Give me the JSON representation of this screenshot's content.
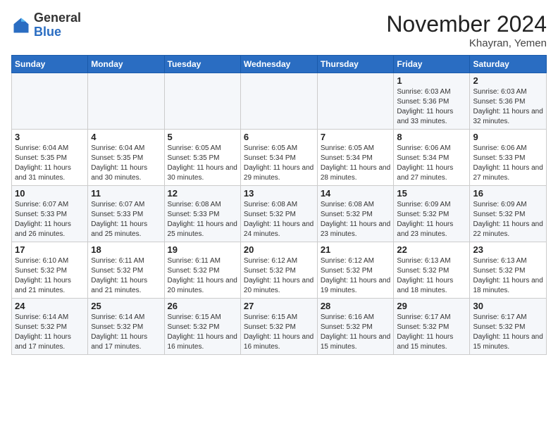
{
  "header": {
    "logo_general": "General",
    "logo_blue": "Blue",
    "month_year": "November 2024",
    "location": "Khayran, Yemen"
  },
  "weekdays": [
    "Sunday",
    "Monday",
    "Tuesday",
    "Wednesday",
    "Thursday",
    "Friday",
    "Saturday"
  ],
  "weeks": [
    [
      {
        "day": "",
        "info": ""
      },
      {
        "day": "",
        "info": ""
      },
      {
        "day": "",
        "info": ""
      },
      {
        "day": "",
        "info": ""
      },
      {
        "day": "",
        "info": ""
      },
      {
        "day": "1",
        "info": "Sunrise: 6:03 AM\nSunset: 5:36 PM\nDaylight: 11 hours and 33 minutes."
      },
      {
        "day": "2",
        "info": "Sunrise: 6:03 AM\nSunset: 5:36 PM\nDaylight: 11 hours and 32 minutes."
      }
    ],
    [
      {
        "day": "3",
        "info": "Sunrise: 6:04 AM\nSunset: 5:35 PM\nDaylight: 11 hours and 31 minutes."
      },
      {
        "day": "4",
        "info": "Sunrise: 6:04 AM\nSunset: 5:35 PM\nDaylight: 11 hours and 30 minutes."
      },
      {
        "day": "5",
        "info": "Sunrise: 6:05 AM\nSunset: 5:35 PM\nDaylight: 11 hours and 30 minutes."
      },
      {
        "day": "6",
        "info": "Sunrise: 6:05 AM\nSunset: 5:34 PM\nDaylight: 11 hours and 29 minutes."
      },
      {
        "day": "7",
        "info": "Sunrise: 6:05 AM\nSunset: 5:34 PM\nDaylight: 11 hours and 28 minutes."
      },
      {
        "day": "8",
        "info": "Sunrise: 6:06 AM\nSunset: 5:34 PM\nDaylight: 11 hours and 27 minutes."
      },
      {
        "day": "9",
        "info": "Sunrise: 6:06 AM\nSunset: 5:33 PM\nDaylight: 11 hours and 27 minutes."
      }
    ],
    [
      {
        "day": "10",
        "info": "Sunrise: 6:07 AM\nSunset: 5:33 PM\nDaylight: 11 hours and 26 minutes."
      },
      {
        "day": "11",
        "info": "Sunrise: 6:07 AM\nSunset: 5:33 PM\nDaylight: 11 hours and 25 minutes."
      },
      {
        "day": "12",
        "info": "Sunrise: 6:08 AM\nSunset: 5:33 PM\nDaylight: 11 hours and 25 minutes."
      },
      {
        "day": "13",
        "info": "Sunrise: 6:08 AM\nSunset: 5:32 PM\nDaylight: 11 hours and 24 minutes."
      },
      {
        "day": "14",
        "info": "Sunrise: 6:08 AM\nSunset: 5:32 PM\nDaylight: 11 hours and 23 minutes."
      },
      {
        "day": "15",
        "info": "Sunrise: 6:09 AM\nSunset: 5:32 PM\nDaylight: 11 hours and 23 minutes."
      },
      {
        "day": "16",
        "info": "Sunrise: 6:09 AM\nSunset: 5:32 PM\nDaylight: 11 hours and 22 minutes."
      }
    ],
    [
      {
        "day": "17",
        "info": "Sunrise: 6:10 AM\nSunset: 5:32 PM\nDaylight: 11 hours and 21 minutes."
      },
      {
        "day": "18",
        "info": "Sunrise: 6:11 AM\nSunset: 5:32 PM\nDaylight: 11 hours and 21 minutes."
      },
      {
        "day": "19",
        "info": "Sunrise: 6:11 AM\nSunset: 5:32 PM\nDaylight: 11 hours and 20 minutes."
      },
      {
        "day": "20",
        "info": "Sunrise: 6:12 AM\nSunset: 5:32 PM\nDaylight: 11 hours and 20 minutes."
      },
      {
        "day": "21",
        "info": "Sunrise: 6:12 AM\nSunset: 5:32 PM\nDaylight: 11 hours and 19 minutes."
      },
      {
        "day": "22",
        "info": "Sunrise: 6:13 AM\nSunset: 5:32 PM\nDaylight: 11 hours and 18 minutes."
      },
      {
        "day": "23",
        "info": "Sunrise: 6:13 AM\nSunset: 5:32 PM\nDaylight: 11 hours and 18 minutes."
      }
    ],
    [
      {
        "day": "24",
        "info": "Sunrise: 6:14 AM\nSunset: 5:32 PM\nDaylight: 11 hours and 17 minutes."
      },
      {
        "day": "25",
        "info": "Sunrise: 6:14 AM\nSunset: 5:32 PM\nDaylight: 11 hours and 17 minutes."
      },
      {
        "day": "26",
        "info": "Sunrise: 6:15 AM\nSunset: 5:32 PM\nDaylight: 11 hours and 16 minutes."
      },
      {
        "day": "27",
        "info": "Sunrise: 6:15 AM\nSunset: 5:32 PM\nDaylight: 11 hours and 16 minutes."
      },
      {
        "day": "28",
        "info": "Sunrise: 6:16 AM\nSunset: 5:32 PM\nDaylight: 11 hours and 15 minutes."
      },
      {
        "day": "29",
        "info": "Sunrise: 6:17 AM\nSunset: 5:32 PM\nDaylight: 11 hours and 15 minutes."
      },
      {
        "day": "30",
        "info": "Sunrise: 6:17 AM\nSunset: 5:32 PM\nDaylight: 11 hours and 15 minutes."
      }
    ]
  ]
}
